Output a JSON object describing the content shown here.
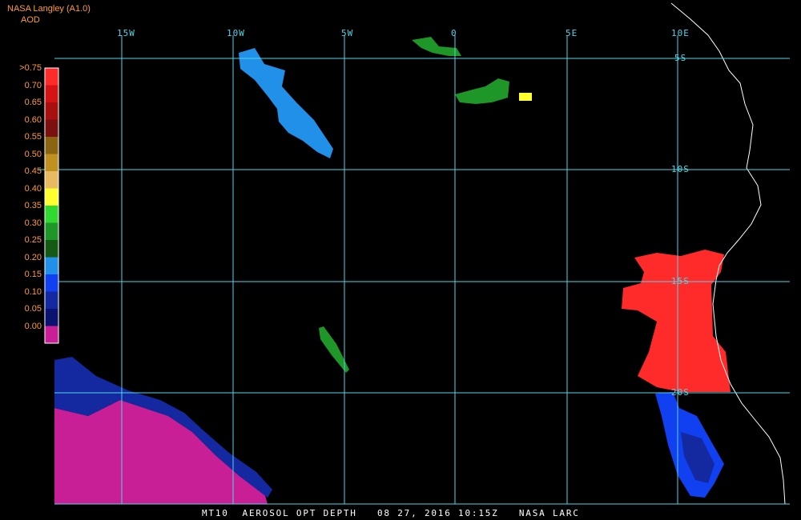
{
  "header": {
    "source": "NASA Langley (A1.0)",
    "product": "AOD"
  },
  "legend": {
    "items": [
      {
        "label": ">0.75",
        "color": "#ff2a2a"
      },
      {
        "label": "0.70",
        "color": "#d41414"
      },
      {
        "label": "0.65",
        "color": "#a80f0f"
      },
      {
        "label": "0.60",
        "color": "#7a1010"
      },
      {
        "label": "0.55",
        "color": "#8a6410"
      },
      {
        "label": "0.50",
        "color": "#c09020"
      },
      {
        "label": "0.45",
        "color": "#e8bb60"
      },
      {
        "label": "0.40",
        "color": "#ffff30"
      },
      {
        "label": "0.35",
        "color": "#30d830"
      },
      {
        "label": "0.30",
        "color": "#1e9628"
      },
      {
        "label": "0.25",
        "color": "#145a14"
      },
      {
        "label": "0.20",
        "color": "#2090e8"
      },
      {
        "label": "0.15",
        "color": "#1040f0"
      },
      {
        "label": "0.10",
        "color": "#1428a0"
      },
      {
        "label": "0.05",
        "color": "#0a1470"
      },
      {
        "label": "0.00",
        "color": "#c81e96"
      }
    ]
  },
  "grid": {
    "longitudes": [
      "15W",
      "10W",
      "5W",
      "0",
      "5E",
      "10E"
    ],
    "latitudes": [
      "5S",
      "10S",
      "15S",
      "20S"
    ]
  },
  "footer": {
    "text": "MT10  AEROSOL OPT DEPTH   08 27, 2016 10:15Z   NASA LARC"
  },
  "colors": {
    "grid": "#4fd6e8",
    "coastline": "#ffffff",
    "label_text": "#ff9b3a"
  }
}
